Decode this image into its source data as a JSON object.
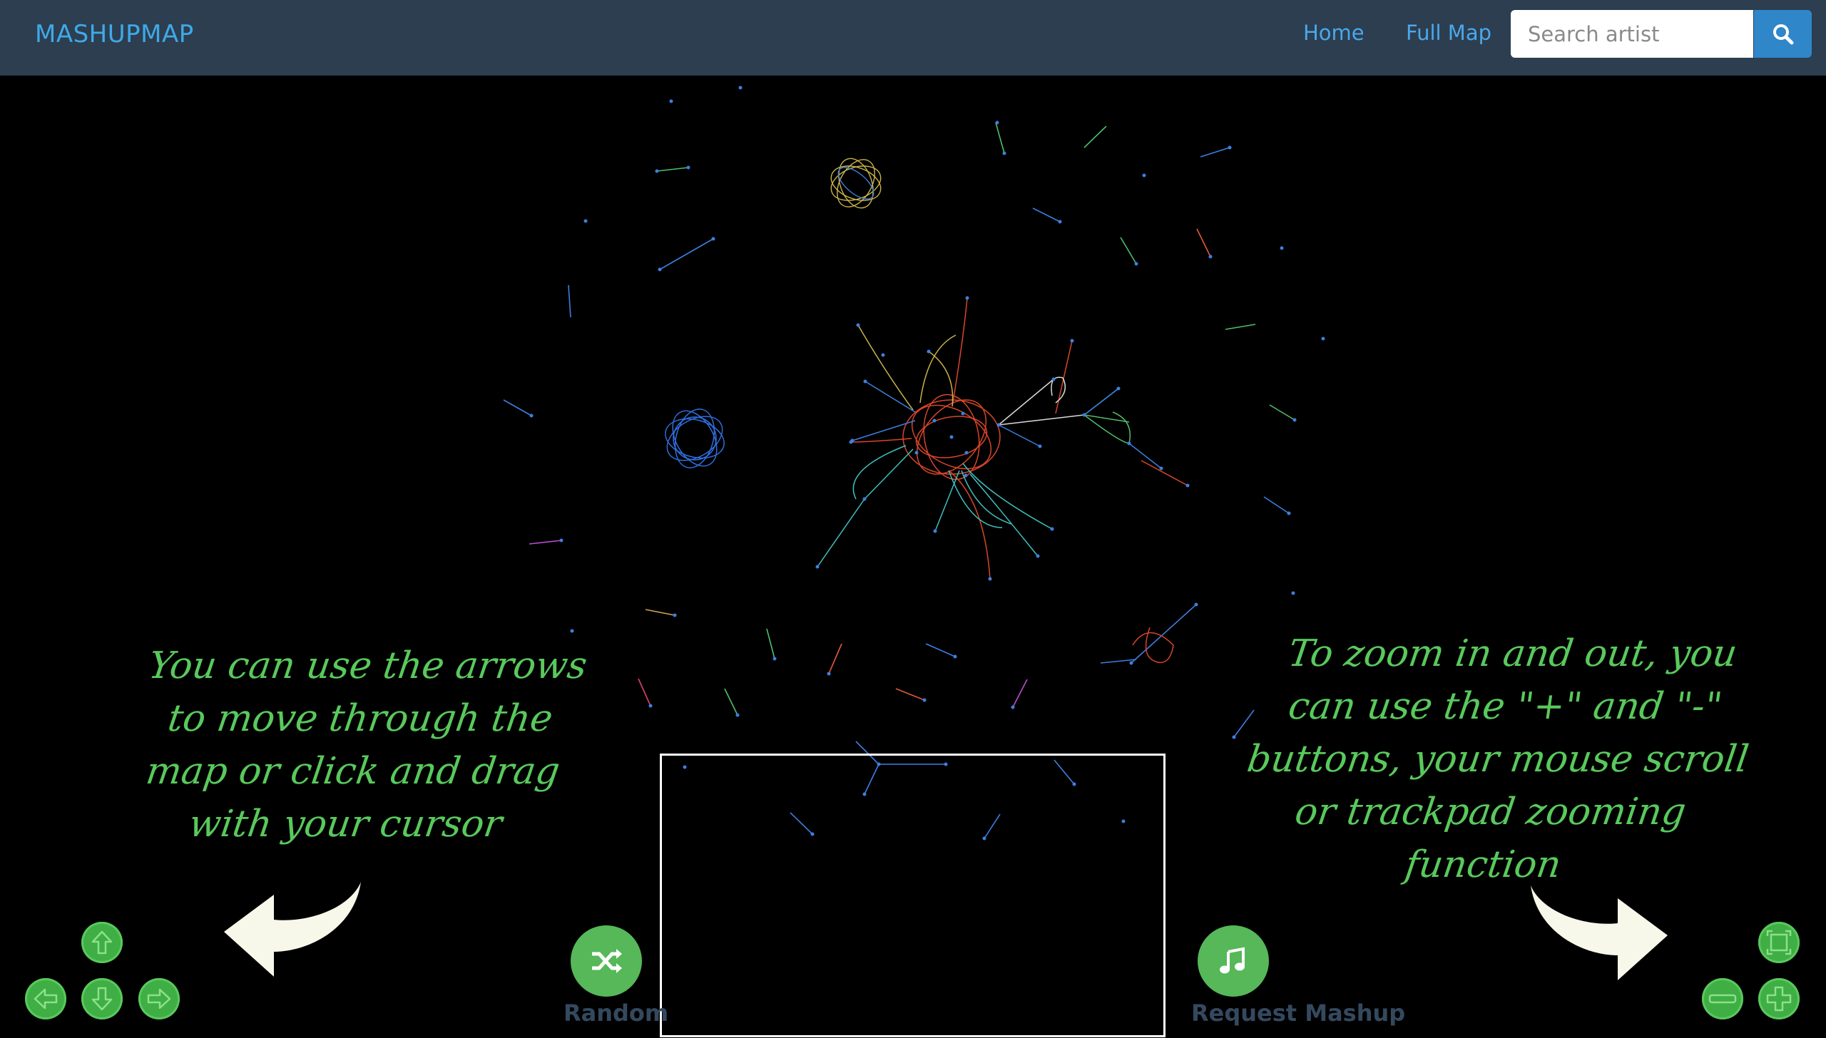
{
  "navbar": {
    "brand": "MASHUPMAP",
    "links": [
      "Home",
      "Full Map"
    ],
    "search_placeholder": "Search artist",
    "search_icon": "search-icon"
  },
  "hints": {
    "left": "You can use the arrows to move through the map or click and drag with your cursor",
    "right": "To zoom in and out, you can use the \"+\" and \"-\" buttons, your mouse scroll or trackpad zooming function"
  },
  "buttons": {
    "random_label": "Random",
    "random_icon": "shuffle-icon",
    "request_label": "Request Mashup",
    "request_icon": "music-note-icon"
  },
  "controls": {
    "pan": [
      "arrow-up-icon",
      "arrow-left-icon",
      "arrow-down-icon",
      "arrow-right-icon"
    ],
    "zoom": [
      "fit-screen-icon",
      "zoom-out-icon",
      "zoom-in-icon"
    ]
  },
  "colors": {
    "navbar": "#2c3e50",
    "brand": "#3fa9e8",
    "hint_text": "#59c95c",
    "button_green": "#56b858",
    "node_blue": "#3d7fe0",
    "cluster_red": "#d8452a"
  }
}
